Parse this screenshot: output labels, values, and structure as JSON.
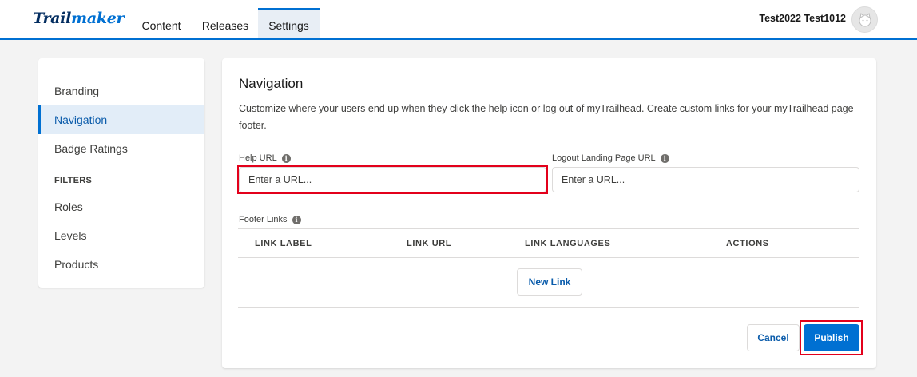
{
  "header": {
    "logo_part1": "Trail",
    "logo_part2": "maker",
    "tabs": [
      {
        "label": "Content"
      },
      {
        "label": "Releases"
      },
      {
        "label": "Settings"
      }
    ],
    "user_name": "Test2022 Test1012",
    "accent_color": "#0070d2"
  },
  "sidebar": {
    "items": [
      {
        "label": "Branding"
      },
      {
        "label": "Navigation"
      },
      {
        "label": "Badge Ratings"
      }
    ],
    "filters_heading": "FILTERS",
    "filter_items": [
      {
        "label": "Roles"
      },
      {
        "label": "Levels"
      },
      {
        "label": "Products"
      }
    ]
  },
  "main": {
    "title": "Navigation",
    "description": "Customize where your users end up when they click the help icon or log out of myTrailhead. Create custom links for your myTrailhead page footer.",
    "help_url": {
      "label": "Help URL",
      "placeholder": "Enter a URL...",
      "value": ""
    },
    "logout_url": {
      "label": "Logout Landing Page URL",
      "placeholder": "Enter a URL...",
      "value": ""
    },
    "footer_links_label": "Footer Links",
    "table_columns": [
      "LINK LABEL",
      "LINK URL",
      "LINK LANGUAGES",
      "ACTIONS"
    ],
    "new_link_label": "New Link",
    "cancel_label": "Cancel",
    "publish_label": "Publish"
  },
  "highlight_color": "#e3001b"
}
